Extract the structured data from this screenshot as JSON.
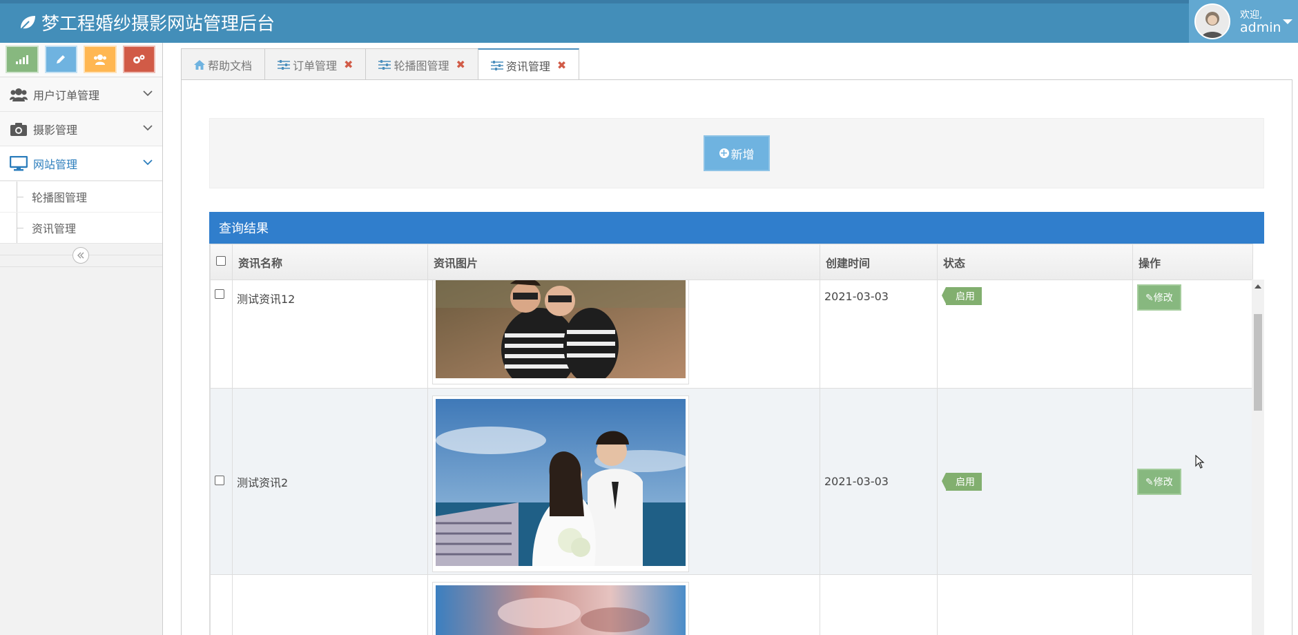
{
  "header": {
    "title": "梦工程婚纱摄影网站管理后台",
    "welcome": "欢迎,",
    "username": "admin",
    "bg_color": "#438eb9"
  },
  "sidebar": {
    "menu": [
      {
        "label": "用户订单管理",
        "icon": "users-icon"
      },
      {
        "label": "摄影管理",
        "icon": "camera-icon"
      },
      {
        "label": "网站管理",
        "icon": "desktop-icon",
        "active": true
      }
    ],
    "submenu": [
      {
        "label": "轮播图管理"
      },
      {
        "label": "资讯管理"
      }
    ]
  },
  "tabs": [
    {
      "label": "帮助文档",
      "icon": "home-icon",
      "closable": false
    },
    {
      "label": "订单管理",
      "icon": "sliders-icon",
      "closable": true
    },
    {
      "label": "轮播图管理",
      "icon": "sliders-icon",
      "closable": true
    },
    {
      "label": "资讯管理",
      "icon": "sliders-icon",
      "closable": true,
      "active": true
    }
  ],
  "toolbar": {
    "add_label": "新增"
  },
  "results": {
    "title": "查询结果",
    "columns": [
      "资讯名称",
      "资讯图片",
      "创建时间",
      "状态",
      "操作"
    ],
    "rows": [
      {
        "name": "测试资讯12",
        "created": "2021-03-03",
        "status": "启用",
        "action": "修改"
      },
      {
        "name": "测试资讯2",
        "created": "2021-03-03",
        "status": "启用",
        "action": "修改"
      },
      {
        "name": "",
        "created": "",
        "status": "",
        "action": ""
      }
    ]
  },
  "colors": {
    "accent": "#438eb9",
    "result_header": "#307ecc",
    "status_badge": "#82af6f",
    "edit_button": "#87b87f",
    "close_x": "#d15b47"
  }
}
